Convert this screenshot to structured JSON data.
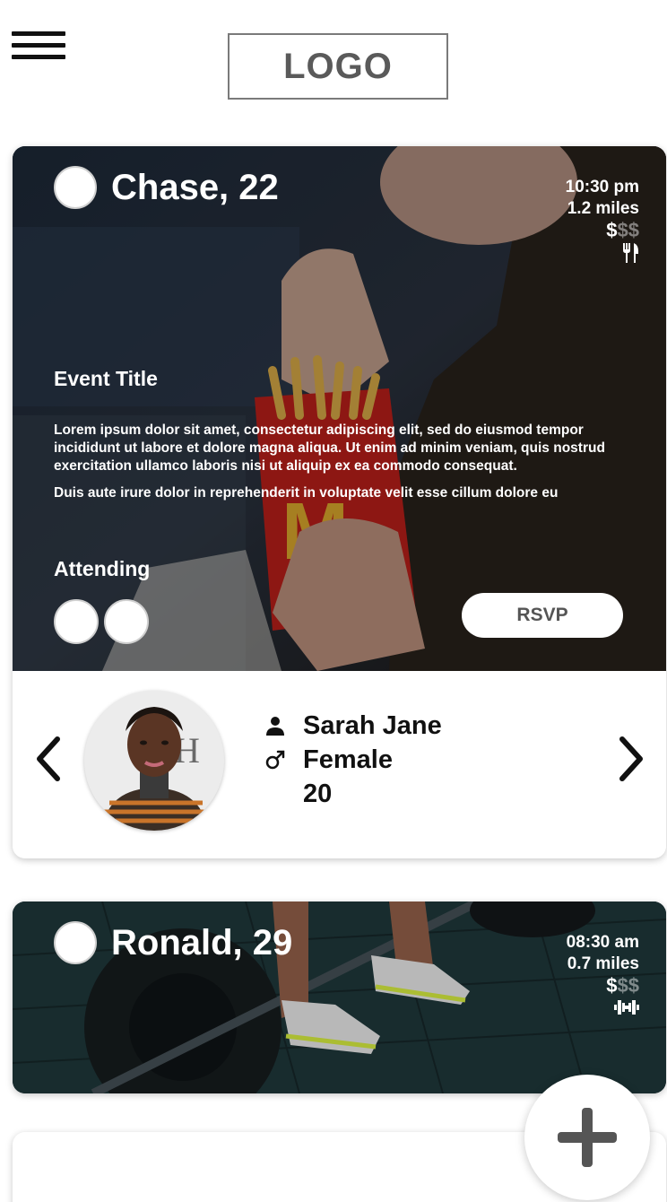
{
  "header": {
    "logo_text": "LOGO",
    "menu_icon": "hamburger-menu-icon"
  },
  "events": [
    {
      "host": "Chase, 22",
      "time": "10:30 pm",
      "distance": "1.2 miles",
      "price_active": "$",
      "price_inactive": "$$",
      "category_icon": "utensils-icon",
      "title": "Event Title",
      "description": [
        "Lorem ipsum dolor sit amet, consectetur adipiscing elit, sed do eiusmod tempor incididunt ut labore et dolore magna aliqua. Ut enim ad minim veniam, quis nostrud exercitation ullamco laboris nisi ut aliquip ex ea commodo consequat.",
        "Duis aute irure dolor in reprehenderit in voluptate velit esse cillum dolore eu"
      ],
      "attending_label": "Attending",
      "rsvp_label": "RSVP",
      "attendee": {
        "name": "Sarah Jane",
        "gender": "Female",
        "age": "20"
      }
    },
    {
      "host": "Ronald, 29",
      "time": "08:30 am",
      "distance": "0.7 miles",
      "price_active": "$",
      "price_inactive": "$$",
      "category_icon": "dumbbell-icon"
    }
  ],
  "fab": {
    "icon": "plus-icon"
  }
}
